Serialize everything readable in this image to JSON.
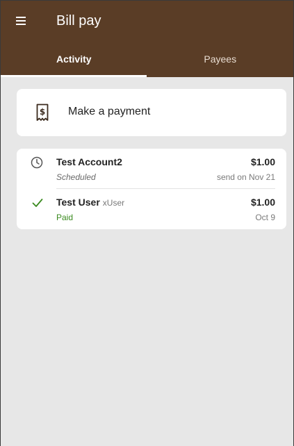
{
  "header": {
    "title": "Bill pay",
    "background_color": "#5a3d26",
    "icons": {
      "menu": "hamburger-menu-icon"
    }
  },
  "tabs": [
    {
      "label": "Activity",
      "active": true
    },
    {
      "label": "Payees",
      "active": false
    }
  ],
  "make_payment": {
    "label": "Make a payment",
    "icon": "receipt-dollar-icon"
  },
  "activity": [
    {
      "name": "Test Account2",
      "nickname": "",
      "amount": "$1.00",
      "status": "Scheduled",
      "date": "send on Nov 21",
      "icon": "clock-icon"
    },
    {
      "name": "Test User",
      "nickname": "xUser",
      "amount": "$1.00",
      "status": "Paid",
      "date": "Oct 9",
      "icon": "check-icon",
      "status_color": "#3a8a1f"
    }
  ],
  "colors": {
    "background": "#e7e7e7",
    "paid_green": "#3a8a1f"
  }
}
